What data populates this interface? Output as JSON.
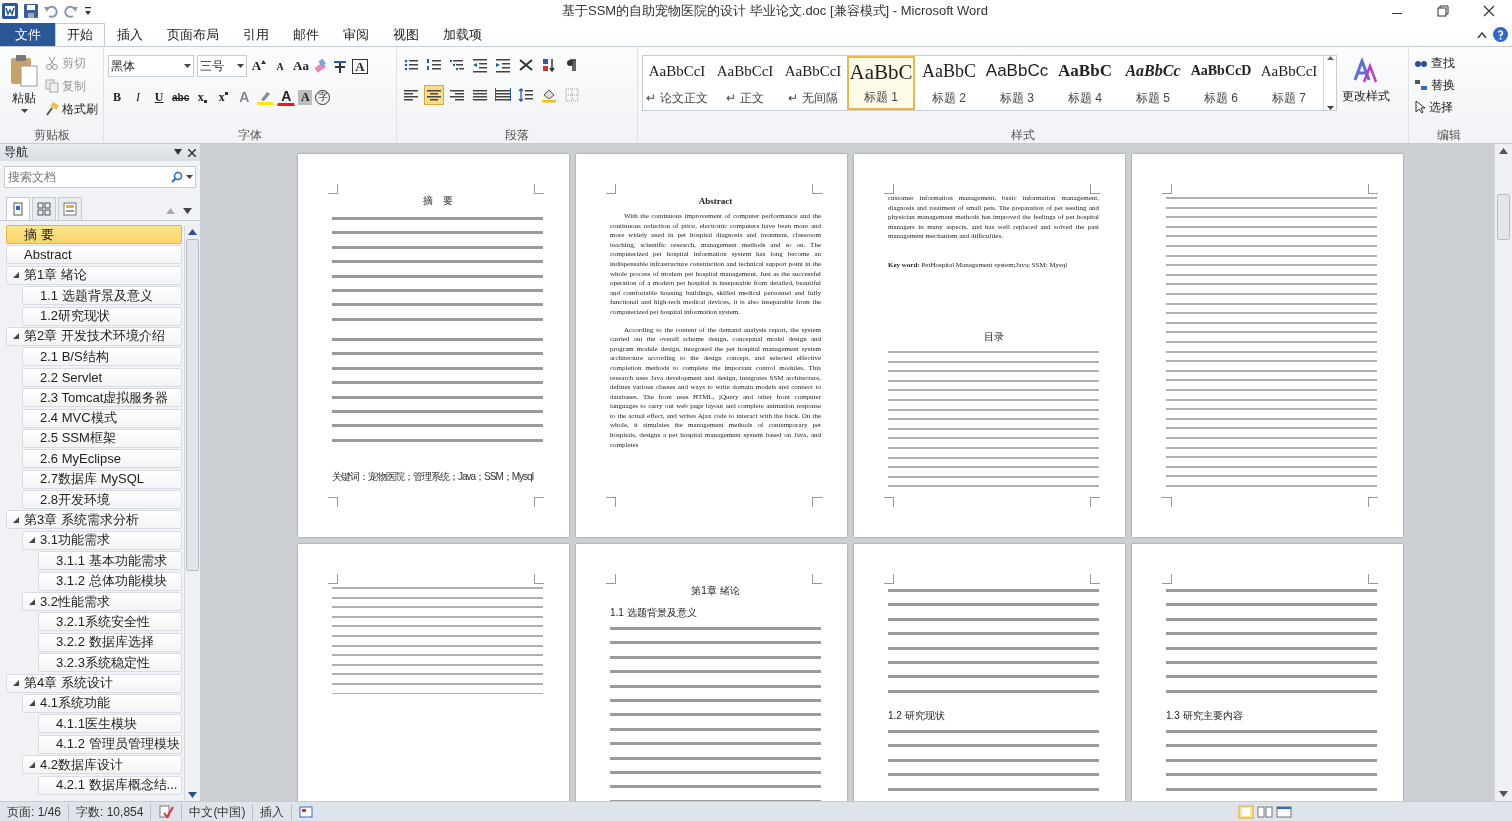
{
  "window": {
    "title": "基于SSM的自助宠物医院的设计 毕业论文.doc [兼容模式] - Microsoft Word"
  },
  "tabs": [
    {
      "label": "文件",
      "kind": "file",
      "selected": false
    },
    {
      "label": "开始",
      "kind": "tab",
      "selected": true
    },
    {
      "label": "插入",
      "kind": "tab",
      "selected": false
    },
    {
      "label": "页面布局",
      "kind": "tab",
      "selected": false
    },
    {
      "label": "引用",
      "kind": "tab",
      "selected": false
    },
    {
      "label": "邮件",
      "kind": "tab",
      "selected": false
    },
    {
      "label": "审阅",
      "kind": "tab",
      "selected": false
    },
    {
      "label": "视图",
      "kind": "tab",
      "selected": false
    },
    {
      "label": "加载项",
      "kind": "tab",
      "selected": false
    }
  ],
  "clipboard": {
    "label": "剪贴板",
    "paste": "粘贴",
    "cut": "剪切",
    "copy": "复制",
    "painter": "格式刷"
  },
  "font": {
    "label": "字体",
    "name": "黑体",
    "size": "三号",
    "row1": [
      {
        "kind": "grow",
        "label": "A"
      },
      {
        "kind": "shrink",
        "label": "A"
      },
      {
        "kind": "case",
        "label": "Aa"
      },
      {
        "kind": "clear"
      },
      {
        "kind": "phonetic"
      },
      {
        "kind": "border",
        "label": "A"
      }
    ],
    "row2": [
      {
        "kind": "bold",
        "label": "B"
      },
      {
        "kind": "italic",
        "label": "I"
      },
      {
        "kind": "underline",
        "label": "U"
      },
      {
        "kind": "strike",
        "label": "abc"
      },
      {
        "kind": "sub",
        "label": "x"
      },
      {
        "kind": "sup",
        "label": "x"
      },
      {
        "kind": "effects",
        "label": "A"
      },
      {
        "kind": "highlight"
      },
      {
        "kind": "color",
        "label": "A"
      },
      {
        "kind": "shade",
        "label": "A"
      },
      {
        "kind": "enclose",
        "label": "字"
      }
    ]
  },
  "paragraph": {
    "label": "段落",
    "row1": [
      {
        "kind": "bullets"
      },
      {
        "kind": "numbering"
      },
      {
        "kind": "multilevel"
      },
      {
        "kind": "outdent"
      },
      {
        "kind": "indent"
      },
      {
        "kind": "asian"
      },
      {
        "kind": "sort"
      },
      {
        "kind": "marks"
      }
    ],
    "row2": [
      {
        "kind": "align-left",
        "selected": false
      },
      {
        "kind": "align-center",
        "selected": true
      },
      {
        "kind": "align-right",
        "selected": false
      },
      {
        "kind": "justify",
        "selected": false
      },
      {
        "kind": "distribute",
        "selected": false
      },
      {
        "kind": "spacing"
      },
      {
        "kind": "shading"
      },
      {
        "kind": "borders"
      }
    ]
  },
  "styles": {
    "label": "样式",
    "change": "更改样式",
    "items": [
      {
        "preview": "AaBbCcI",
        "name": "↵ 论文正文",
        "kind": "body",
        "selected": false
      },
      {
        "preview": "AaBbCcI",
        "name": "↵ 正文",
        "kind": "body",
        "selected": false
      },
      {
        "preview": "AaBbCcI",
        "name": "↵ 无间隔",
        "kind": "body",
        "selected": false
      },
      {
        "preview": "AaBbC",
        "name": "标题 1",
        "kind": "h1",
        "selected": true
      },
      {
        "preview": "AaBbC",
        "name": "标题 2",
        "kind": "h2",
        "selected": false
      },
      {
        "preview": "AaBbCc",
        "name": "标题 3",
        "kind": "h3",
        "selected": false
      },
      {
        "preview": "AaBbC",
        "name": "标题 4",
        "kind": "h4",
        "selected": false
      },
      {
        "preview": "AaBbCc",
        "name": "标题 5",
        "kind": "h5",
        "selected": false
      },
      {
        "preview": "AaBbCcD",
        "name": "标题 6",
        "kind": "h6",
        "selected": false
      },
      {
        "preview": "AaBbCcI",
        "name": "标题 7",
        "kind": "h7",
        "selected": false
      }
    ]
  },
  "editing": {
    "label": "编辑",
    "find": "查找",
    "replace": "替换",
    "select": "选择"
  },
  "navigation": {
    "title": "导航",
    "search": {
      "placeholder": "搜索文档"
    },
    "items": [
      {
        "label": "摘 要",
        "selected": true
      },
      {
        "label": "Abstract",
        "selected": false
      },
      {
        "label": "第1章 绪论",
        "selected": false,
        "expanded": true,
        "children": [
          {
            "label": "1.1 选题背景及意义",
            "selected": false
          },
          {
            "label": "1.2研究现状",
            "selected": false
          }
        ]
      },
      {
        "label": "第2章 开发技术环境介绍",
        "selected": false,
        "expanded": true,
        "children": [
          {
            "label": "2.1 B/S结构",
            "selected": false
          },
          {
            "label": "2.2 Servlet",
            "selected": false
          },
          {
            "label": "2.3 Tomcat虚拟服务器",
            "selected": false
          },
          {
            "label": "2.4 MVC模式",
            "selected": false
          },
          {
            "label": "2.5 SSM框架",
            "selected": false
          },
          {
            "label": "2.6 MyEclipse",
            "selected": false
          },
          {
            "label": "2.7数据库 MySQL",
            "selected": false
          },
          {
            "label": "2.8开发环境",
            "selected": false
          }
        ]
      },
      {
        "label": "第3章 系统需求分析",
        "selected": false,
        "expanded": true,
        "children": [
          {
            "label": "3.1功能需求",
            "selected": false,
            "expanded": true,
            "children": [
              {
                "label": "3.1.1 基本功能需求",
                "selected": false
              },
              {
                "label": "3.1.2 总体功能模块",
                "selected": false
              }
            ]
          },
          {
            "label": "3.2性能需求",
            "selected": false,
            "expanded": true,
            "children": [
              {
                "label": "3.2.1系统安全性",
                "selected": false
              },
              {
                "label": "3.2.2 数据库选择",
                "selected": false
              },
              {
                "label": "3.2.3系统稳定性",
                "selected": false
              }
            ]
          }
        ]
      },
      {
        "label": "第4章 系统设计",
        "selected": false,
        "expanded": true,
        "children": [
          {
            "label": "4.1系统功能",
            "selected": false,
            "expanded": true,
            "children": [
              {
                "label": "4.1.1医生模块",
                "selected": false
              },
              {
                "label": "4.1.2 管理员管理模块",
                "selected": false
              }
            ]
          },
          {
            "label": "4.2数据库设计",
            "selected": false,
            "expanded": true,
            "children": [
              {
                "label": "4.2.1 数据库概念结...",
                "selected": false
              }
            ]
          }
        ]
      }
    ]
  },
  "pages": [
    {
      "blocks": [
        {
          "kind": "title",
          "text": "摘　要"
        },
        {
          "kind": "lines"
        },
        {
          "kind": "lines"
        },
        {
          "kind": "keywords",
          "text": "关键词：宠物医院；管理系统；Java；SSM；Mysql"
        }
      ]
    },
    {
      "blocks": [
        {
          "kind": "title-bold",
          "text": "Abstract"
        },
        {
          "kind": "paragraph",
          "text": "With the continuous improvement of computer performance and the continuous reduction of price, electronic computers have been more and more widely used in pet hospital diagnosis and treatment, classroom teaching, scientific research, management methods and so on. The computerized pet hospital information system has long become an indispensable infrastructure construction and technical support point in the whole process of modern pet hospital management. Just as the successful operation of a modern pet hospital is inseparable from detailed, beautiful and comfortable housing buildings, skilled medical personnel and fully functional and high-tech medical devices, it is also inseparable from the computerized pet hospital information system."
        },
        {
          "kind": "paragraph",
          "text": "According to the content of the demand analysis report, the system carried out the overall scheme design, conceptual model design and program module design, integrated the pet hospital management system architecture according to the design concept, and selected effective completion methods to complete the important control modules. This research uses Java development and design, integrates SSM architecture, defines various classes and ways to write domain models and connect to databases. The front uses HTML, jQuery and other front computer languages to carry out web page layout and complete animation response to the actual effect, and writes Ajax code to interact with the back. On the whole, it simulates the management methods of contemporary pet hospitals, designs a pet hospital management system based on Java, and completes"
        }
      ]
    },
    {
      "blocks": [
        {
          "kind": "paragraph-plain",
          "text": "customer information management, basic information management, diagnosis and treatment of small pets. The preparation of pet seeding and physician management methods has improved the feelings of pet hospital managers in many aspects, and has well replaced and solved the past management mechanism and difficulties."
        },
        {
          "kind": "keywords-en",
          "text": "**Key word:** PetHospital Management system;Java;  SSM;  Mysql"
        },
        {
          "kind": "title",
          "text": "目录"
        },
        {
          "kind": "toc-fill"
        }
      ]
    },
    {
      "blocks": [
        {
          "kind": "toc-fill"
        }
      ]
    },
    {
      "blocks": [
        {
          "kind": "toc"
        }
      ]
    },
    {
      "blocks": [
        {
          "kind": "title",
          "text": "第1章  绪论"
        },
        {
          "kind": "heading",
          "text": "1.1 选题背景及意义"
        },
        {
          "kind": "lines-fill"
        }
      ]
    },
    {
      "blocks": [
        {
          "kind": "lines"
        },
        {
          "kind": "heading",
          "text": "1.2 研究现状"
        },
        {
          "kind": "lines-fill"
        }
      ]
    },
    {
      "blocks": [
        {
          "kind": "lines"
        },
        {
          "kind": "heading-small",
          "text": "1.3 研究主要内容"
        },
        {
          "kind": "lines-fill"
        }
      ]
    }
  ],
  "status_bar": {
    "page": "页面: 1/46",
    "words": "字数: 10,854",
    "language": "中文(中国)",
    "mode": "插入"
  }
}
